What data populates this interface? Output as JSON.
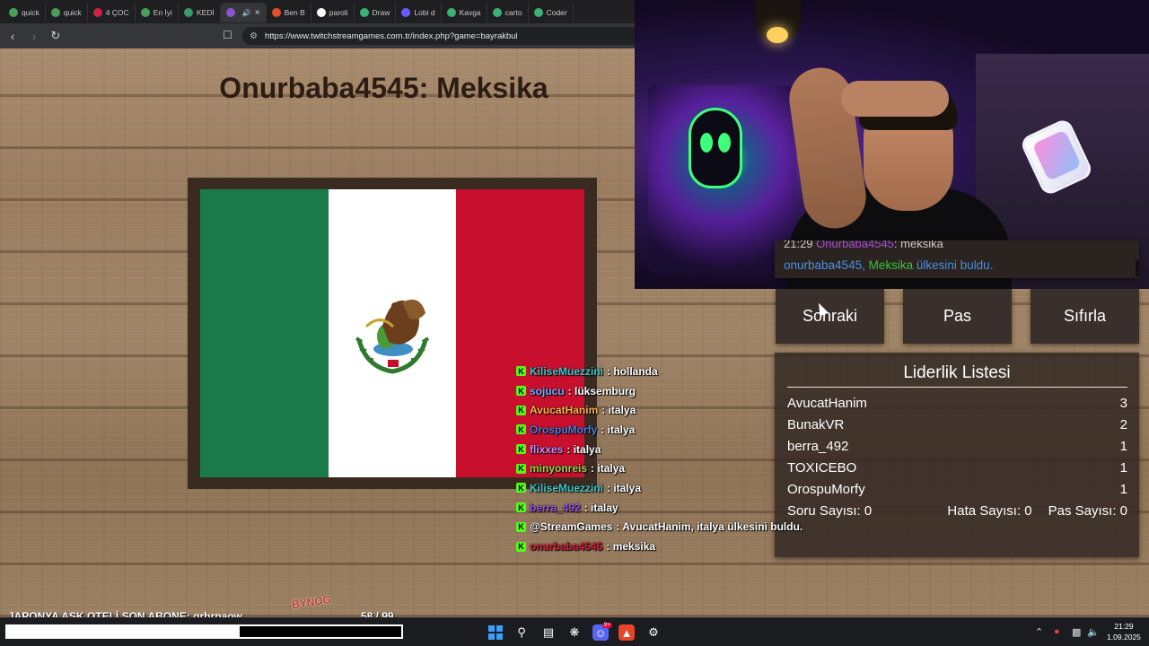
{
  "browser": {
    "tabs": [
      {
        "label": "quick",
        "color": "#4a9e5c",
        "active": false
      },
      {
        "label": "quick",
        "color": "#4a9e5c",
        "active": false
      },
      {
        "label": "4 ÇOC",
        "color": "#cc2244",
        "active": false
      },
      {
        "label": "En İyi",
        "color": "#4a9e5c",
        "active": false
      },
      {
        "label": "KEDİ",
        "color": "#3c9a66",
        "active": false
      },
      {
        "label": "",
        "color": "#8a55d0",
        "active": true
      },
      {
        "label": "Ben B",
        "color": "#e0502a",
        "active": false
      },
      {
        "label": "paroli",
        "color": "#ffffff",
        "active": false
      },
      {
        "label": "Draw",
        "color": "#3bb273",
        "active": false
      },
      {
        "label": "Lobi d",
        "color": "#6a5cff",
        "active": false
      },
      {
        "label": "Kavga",
        "color": "#3bb273",
        "active": false
      },
      {
        "label": "carto",
        "color": "#3bb273",
        "active": false
      },
      {
        "label": "Coder",
        "color": "#3bb273",
        "active": false
      }
    ],
    "url": "https://www.twitchstreamgames.com.tr/index.php?game=bayrakbul"
  },
  "game": {
    "title": "Onurbaba4545: Meksika",
    "flag_colors": [
      "#1a7a4a",
      "#ffffff",
      "#c8102e"
    ]
  },
  "panel": {
    "prev_msg": {
      "time": "21:29",
      "user": "Onurbaba4545",
      "text": ": meksika"
    },
    "message": {
      "user": "onurbaba4545,",
      "country": "Meksika",
      "text": "ülkesini buldu."
    },
    "buttons": {
      "next": "Sonraki",
      "pass": "Pas",
      "reset": "Sıfırla"
    }
  },
  "leaderboard": {
    "title": "Liderlik Listesi",
    "rows": [
      {
        "name": "AvucatHanim",
        "score": "3"
      },
      {
        "name": "BunakVR",
        "score": "2"
      },
      {
        "name": "berra_492",
        "score": "1"
      },
      {
        "name": "TOXICEBO",
        "score": "1"
      },
      {
        "name": "OrospuMorfy",
        "score": "1"
      }
    ],
    "questions": "Soru Sayısı: 0",
    "errors": "Hata Sayısı: 0",
    "passes": "Pas Sayısı: 0"
  },
  "chat": [
    {
      "user": "KiliseMuezzini",
      "color": "#3ec8c8",
      "msg": ": hollanda"
    },
    {
      "user": "sojucu",
      "color": "#6ab0ff",
      "msg": ": lüksemburg"
    },
    {
      "user": "AvucatHanim",
      "color": "#ffb347",
      "msg": ": italya"
    },
    {
      "user": "OrospuMorfy",
      "color": "#4a7bd8",
      "msg": ": italya"
    },
    {
      "user": "flixxes",
      "color": "#c98cf0",
      "msg": ": italya"
    },
    {
      "user": "minyonreis",
      "color": "#8fd44a",
      "msg": ": italya"
    },
    {
      "user": "KiliseMuezzini",
      "color": "#3ec8c8",
      "msg": ": italya"
    },
    {
      "user": "berra_492",
      "color": "#9a55e0",
      "msg": ": italay"
    },
    {
      "user": "@StreamGames",
      "color": "#ffffff",
      "msg": ": AvucatHanim, italya ülkesini buldu."
    },
    {
      "user": "onurbaba4545",
      "color": "#d0203a",
      "msg": ": meksika"
    }
  ],
  "overlay": {
    "ticker": "JAPONYA AŞK OTELİ    SON ABONE: grbrpaow",
    "counter": "58  /  99",
    "progress": 0.59,
    "logo": "BYNOG"
  },
  "taskbar": {
    "time": "21:29",
    "date": "1.09.2025",
    "discord_badge": "9+"
  }
}
